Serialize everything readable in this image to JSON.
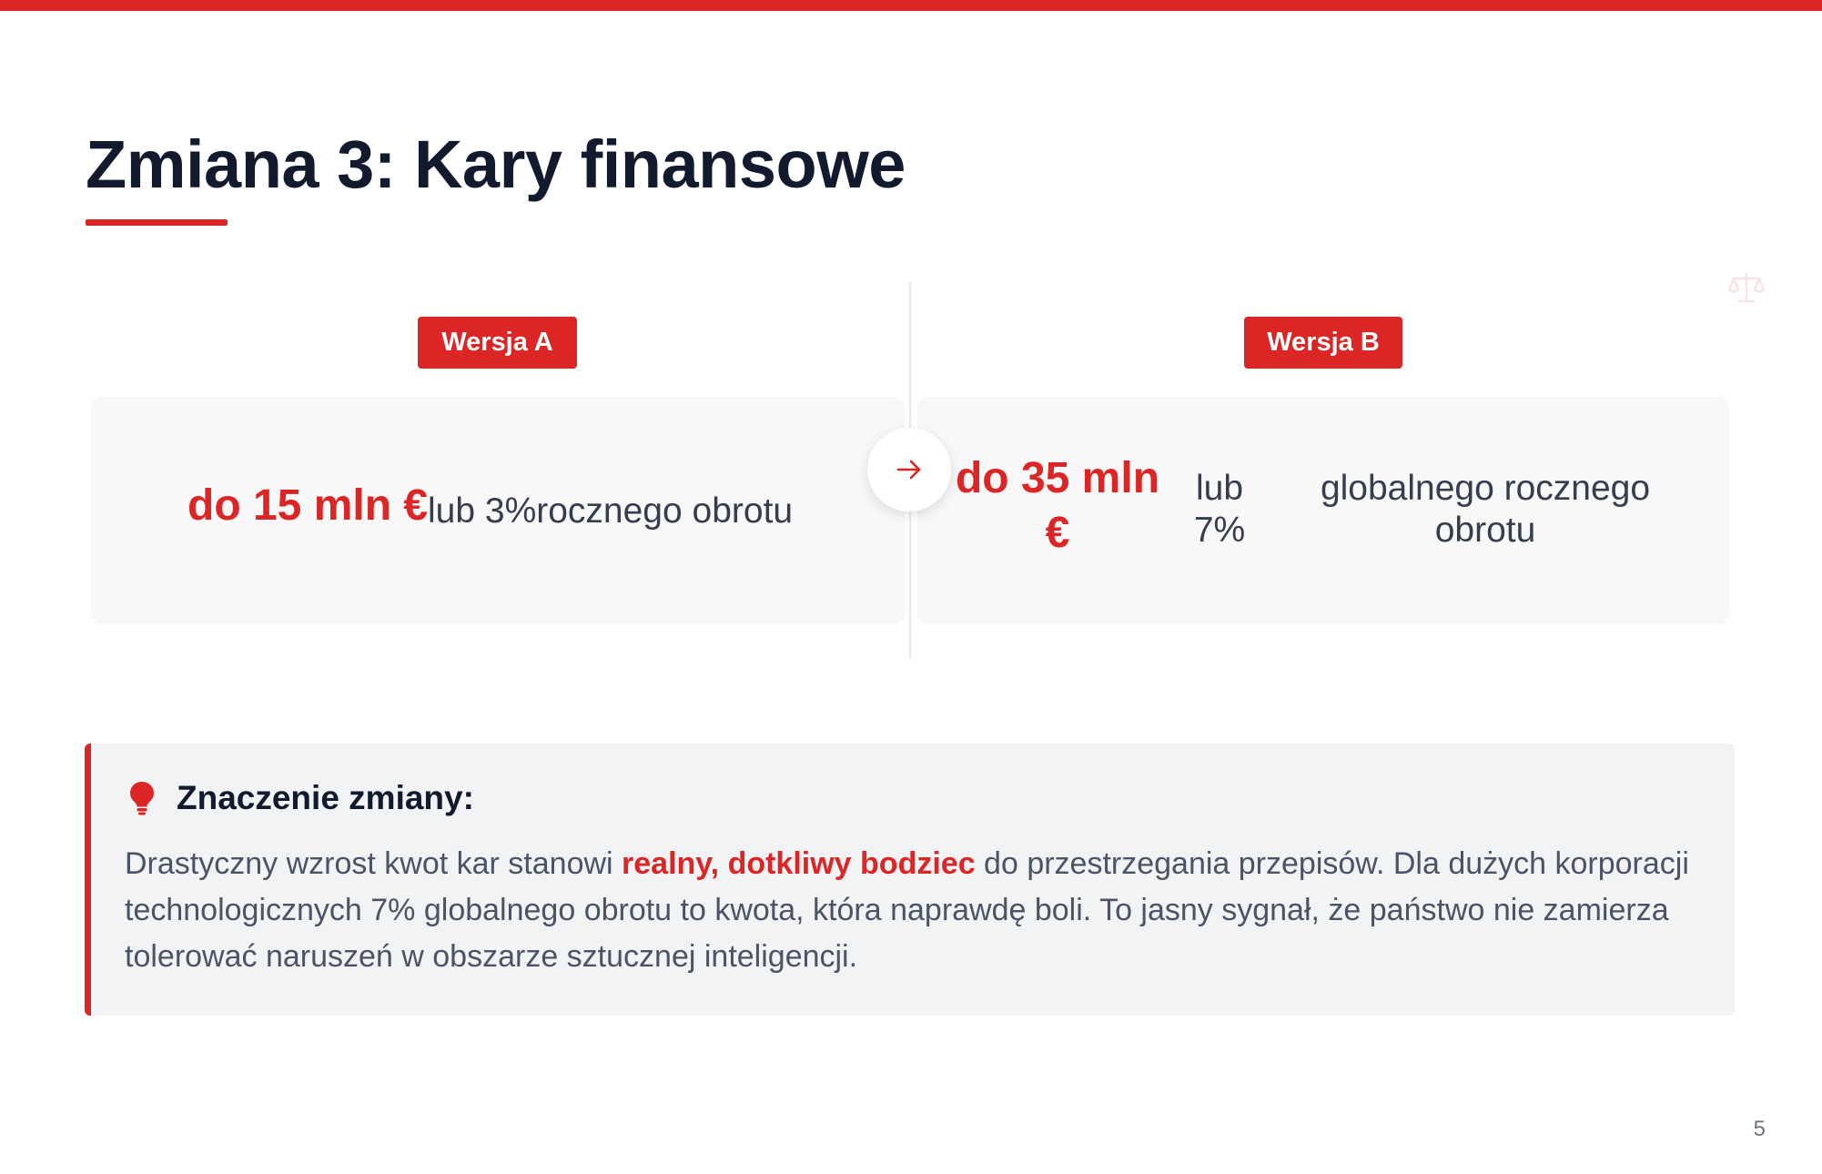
{
  "title": "Zmiana 3: Kary finansowe",
  "colors": {
    "accent": "#dc2626",
    "heading": "#121a2e",
    "body_text": "#4b5466",
    "card_bg": "#f8f8f9",
    "note_bg": "#f2f3f5"
  },
  "icons": {
    "corner": "scale-balance-icon",
    "connector": "arrow-right-icon",
    "note": "lightbulb-icon"
  },
  "comparison": {
    "version_a": {
      "badge": "Wersja A",
      "amount": "do 15 mln €",
      "detail": "lub 3%rocznego obrotu"
    },
    "version_b": {
      "badge": "Wersja B",
      "amount": "do 35 mln €",
      "or_text": "lub 7%",
      "detail": "globalnego rocznego obrotu"
    }
  },
  "note": {
    "heading": "Znaczenie zmiany:",
    "text_before": "Drastyczny wzrost kwot kar stanowi ",
    "highlight": "realny, dotkliwy bodziec",
    "text_after": " do przestrzegania przepisów. Dla dużych korporacji technologicznych 7% globalnego obrotu to kwota, która naprawdę boli. To jasny sygnał, że państwo nie zamierza tolerować naruszeń w obszarze sztucznej inteligencji."
  },
  "page_number": "5"
}
